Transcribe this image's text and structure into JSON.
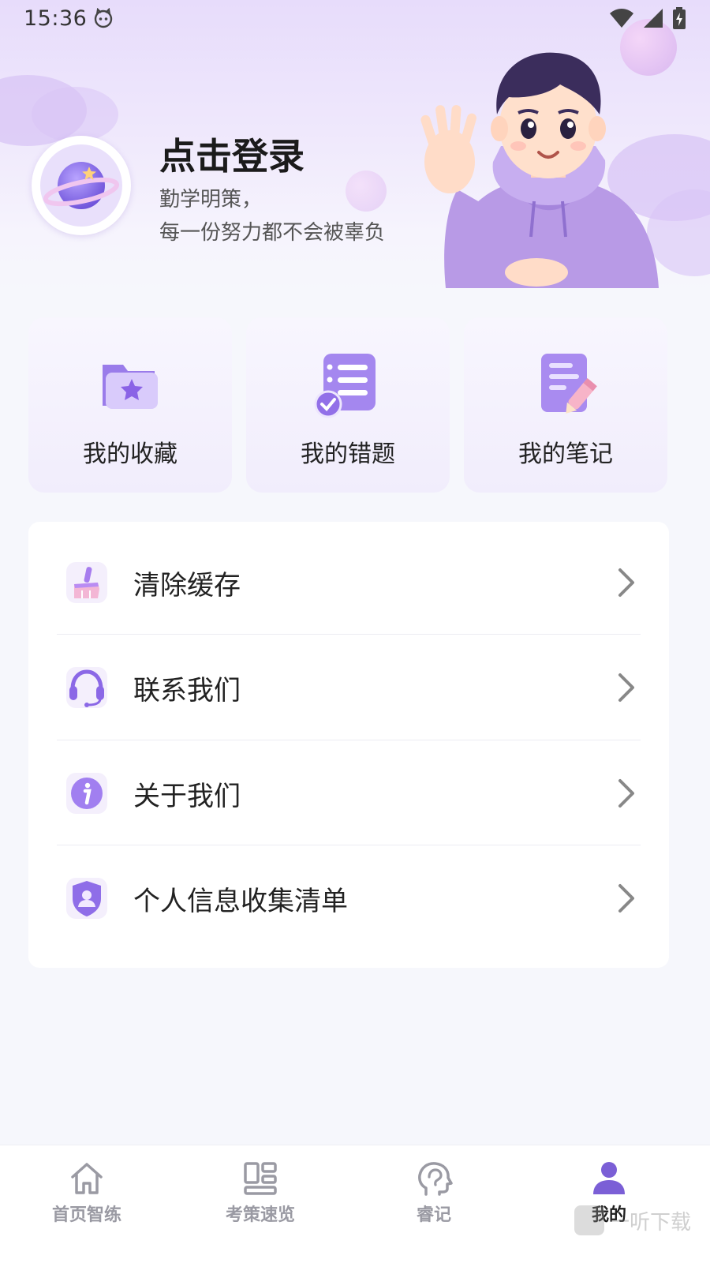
{
  "status_bar": {
    "time": "15:36"
  },
  "profile": {
    "login_text": "点击登录",
    "slogan_line1": "勤学明策，",
    "slogan_line2": "每一份努力都不会被辜负"
  },
  "shortcuts": [
    {
      "label": "我的收藏",
      "icon": "star-folder-icon"
    },
    {
      "label": "我的错题",
      "icon": "checklist-icon"
    },
    {
      "label": "我的笔记",
      "icon": "notebook-pencil-icon"
    }
  ],
  "menu": [
    {
      "label": "清除缓存",
      "icon": "broom-icon"
    },
    {
      "label": "联系我们",
      "icon": "headset-icon"
    },
    {
      "label": "关于我们",
      "icon": "info-icon"
    },
    {
      "label": "个人信息收集清单",
      "icon": "shield-user-icon"
    }
  ],
  "tabbar": [
    {
      "label": "首页智练",
      "icon": "home-icon",
      "active": false
    },
    {
      "label": "考策速览",
      "icon": "layout-icon",
      "active": false
    },
    {
      "label": "睿记",
      "icon": "brain-icon",
      "active": false
    },
    {
      "label": "我的",
      "icon": "person-icon",
      "active": true
    }
  ],
  "watermark": {
    "text": "一听下载"
  },
  "colors": {
    "accent": "#7b5fd6",
    "background": "#f6f7fc",
    "header_tint": "#e7dcfb"
  }
}
